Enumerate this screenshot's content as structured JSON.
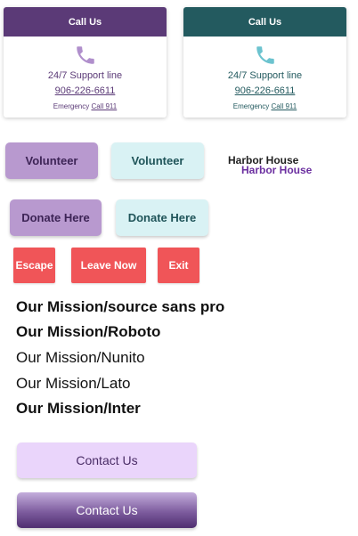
{
  "colors": {
    "purple_dark": "#5b3a77",
    "teal_dark": "#235a5f",
    "purple_light": "#b899cf",
    "teal_light": "#d9f2f4",
    "red": "#f05558",
    "lavender": "#ead5fb"
  },
  "cards": [
    {
      "header": "Call Us",
      "icon": "phone-icon",
      "support_line": "24/7 Support line",
      "phone": "906-226-6611",
      "emergency_prefix": "Emergency",
      "emergency_link": "Call 911"
    },
    {
      "header": "Call Us",
      "icon": "phone-icon",
      "support_line": "24/7 Support line",
      "phone": "906-226-6611",
      "emergency_prefix": "Emergency",
      "emergency_link": "Call 911"
    }
  ],
  "buttons": {
    "volunteer_purple": "Volunteer",
    "volunteer_teal": "Volunteer",
    "donate_purple": "Donate Here",
    "donate_teal": "Donate Here",
    "escape": "Escape",
    "leave_now": "Leave Now",
    "exit": "Exit"
  },
  "harbor": {
    "line1": "Harbor House",
    "line2": "Harbor House"
  },
  "missions": [
    "Our Mission/source sans pro",
    "Our Mission/Roboto",
    "Our Mission/Nunito",
    "Our Mission/Lato",
    "Our Mission/Inter"
  ],
  "contact": {
    "light": "Contact Us",
    "dark": "Contact Us"
  }
}
